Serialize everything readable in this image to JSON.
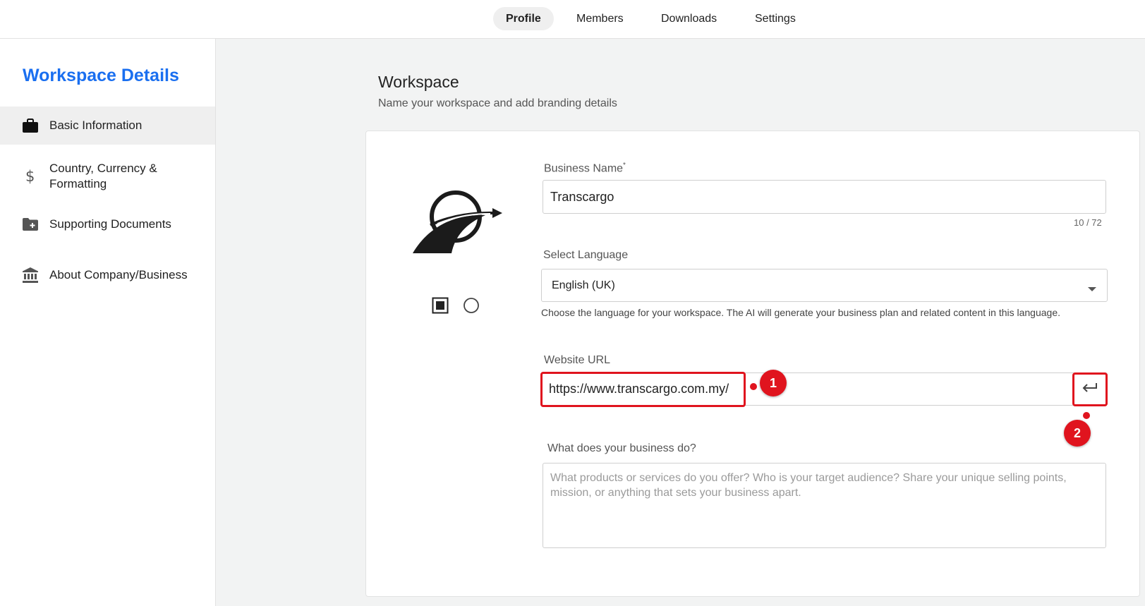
{
  "nav": {
    "tabs": [
      {
        "label": "Profile",
        "active": true
      },
      {
        "label": "Members",
        "active": false
      },
      {
        "label": "Downloads",
        "active": false
      },
      {
        "label": "Settings",
        "active": false
      }
    ]
  },
  "sidebar": {
    "title": "Workspace Details",
    "items": [
      {
        "label": "Basic Information",
        "icon": "briefcase-icon",
        "active": true
      },
      {
        "label": "Country, Currency & Formatting",
        "icon": "dollar-icon",
        "active": false
      },
      {
        "label": "Supporting Documents",
        "icon": "folder-plus-icon",
        "active": false
      },
      {
        "label": "About Company/Business",
        "icon": "bank-icon",
        "active": false
      }
    ]
  },
  "main": {
    "title": "Workspace",
    "subtitle": "Name your workspace and add branding details",
    "business_name": {
      "label": "Business Name",
      "required_mark": "*",
      "value": "Transcargo",
      "counter": "10 / 72"
    },
    "language": {
      "label": "Select Language",
      "value": "English (UK)",
      "helper": "Choose the language for your workspace. The AI will generate your business plan and related content in this language."
    },
    "website": {
      "label": "Website URL",
      "value": "https://www.transcargo.com.my/"
    },
    "business_desc": {
      "label": "What does your business do?",
      "placeholder": "What products or services do you offer? Who is your target audience? Share your unique selling points, mission, or anything that sets your business apart."
    },
    "annotations": {
      "badge1": "1",
      "badge2": "2"
    }
  },
  "colors": {
    "accent": "#1a6ff0",
    "highlight": "#e0141e"
  }
}
